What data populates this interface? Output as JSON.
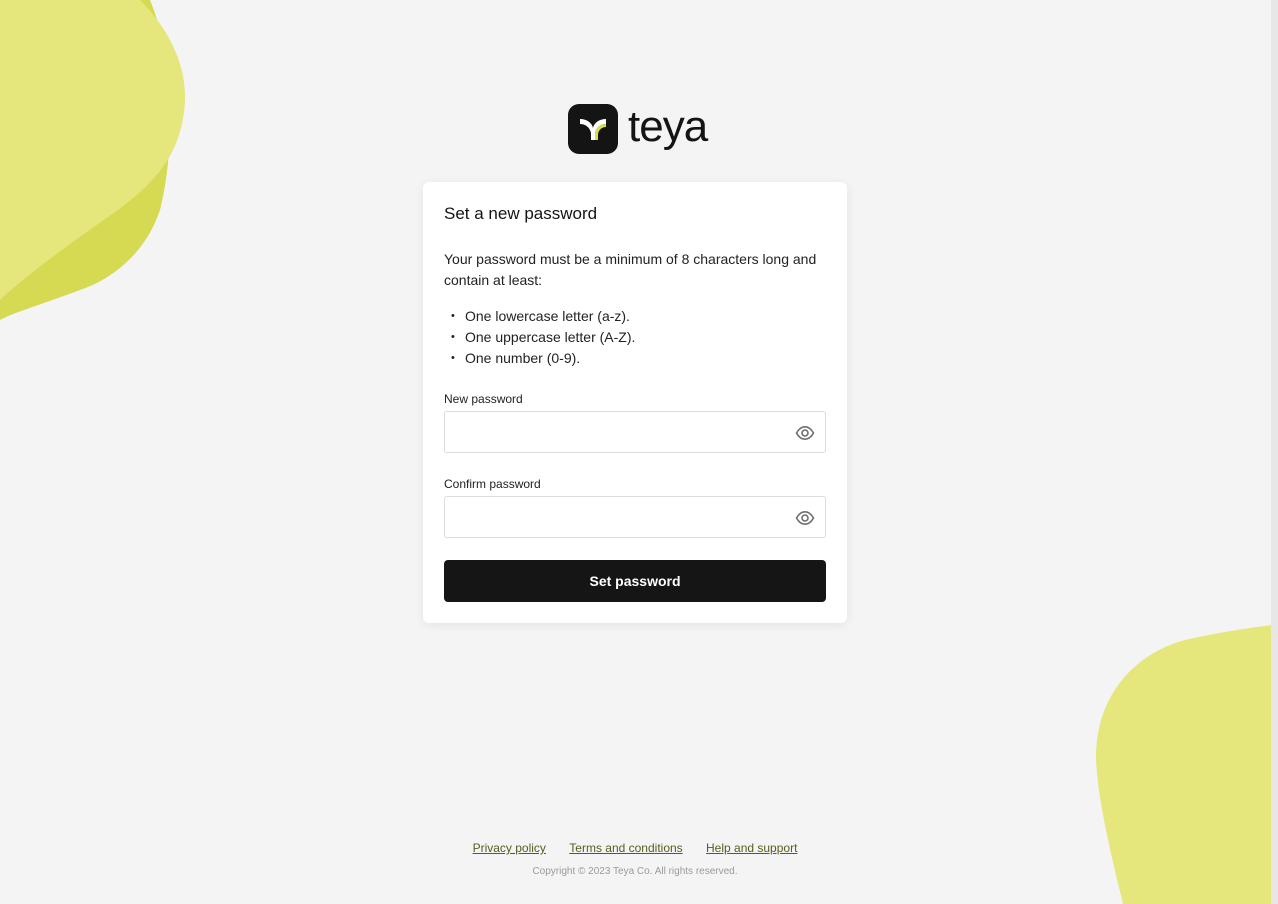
{
  "brand": {
    "name": "teya",
    "accent": "#e5e67c",
    "accent_dark": "#d6da52",
    "mark_icon": "teya-logo-mark-icon"
  },
  "card": {
    "title": "Set a new password",
    "description": "Your password must be a minimum of 8 characters long and contain at least:",
    "rules": [
      "One lowercase letter (a-z).",
      "One uppercase letter (A-Z).",
      "One number (0-9)."
    ]
  },
  "fields": {
    "new_password": {
      "label": "New password",
      "value": "",
      "placeholder": "",
      "icon": "eye-icon"
    },
    "confirm_password": {
      "label": "Confirm password",
      "value": "",
      "placeholder": "",
      "icon": "eye-icon"
    }
  },
  "submit_label": "Set password",
  "footer": {
    "links": [
      "Privacy policy",
      "Terms and conditions",
      "Help and support"
    ],
    "copyright": "Copyright © 2023 Teya Co. All rights reserved."
  }
}
